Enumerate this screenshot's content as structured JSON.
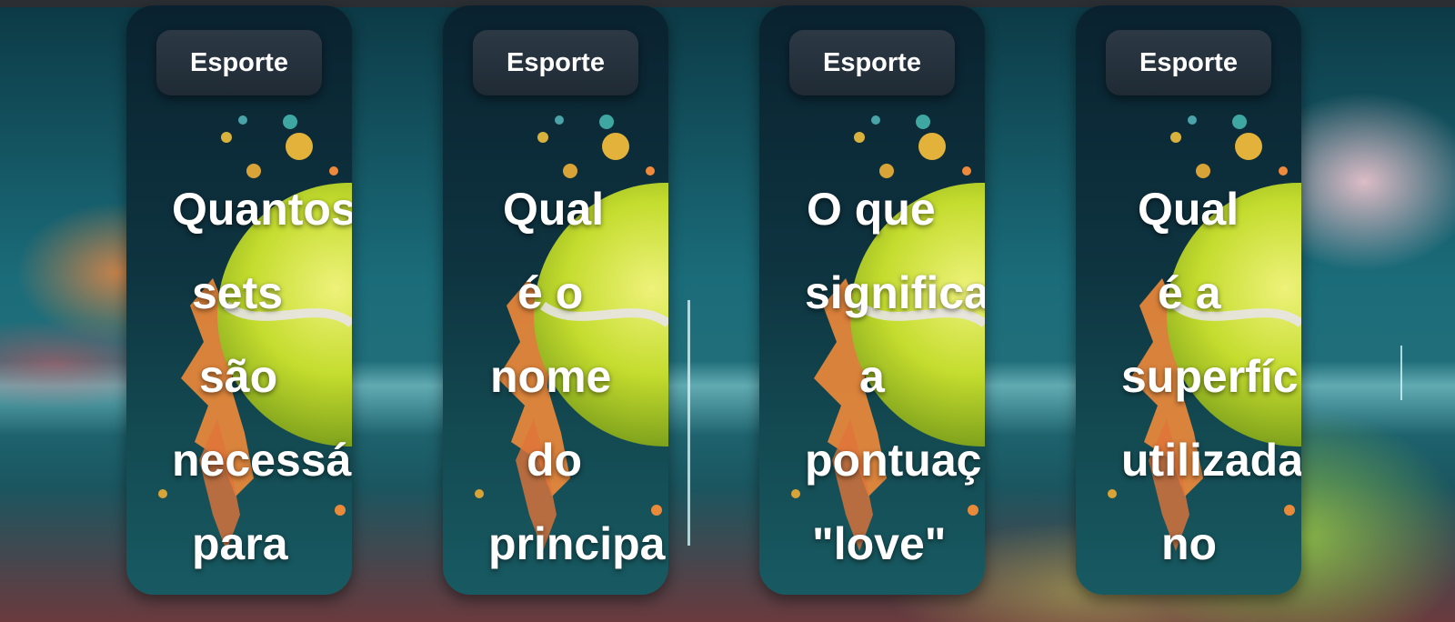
{
  "cards": [
    {
      "category": "Esporte",
      "question_lines": [
        "Quantos",
        "sets",
        "são",
        "necessá",
        "para",
        ""
      ]
    },
    {
      "category": "Esporte",
      "question_lines": [
        "Qual",
        "é o",
        "nome",
        "do",
        "principa",
        ""
      ]
    },
    {
      "category": "Esporte",
      "question_lines": [
        "O que",
        "significa",
        "a",
        "pontuaç",
        "\"love\"",
        ""
      ]
    },
    {
      "category": "Esporte",
      "question_lines": [
        "Qual",
        "é a",
        "superfíc",
        "utilizada",
        "no",
        ""
      ]
    }
  ],
  "colors": {
    "card_background": "#0e3440",
    "chip_background": "#26323d",
    "text": "#ffffff",
    "ball_yellow": "#c8e03a",
    "paint_orange": "#f08a3a"
  },
  "icons": {
    "card_art": "tennis-ball-paint-splash-illustration"
  }
}
